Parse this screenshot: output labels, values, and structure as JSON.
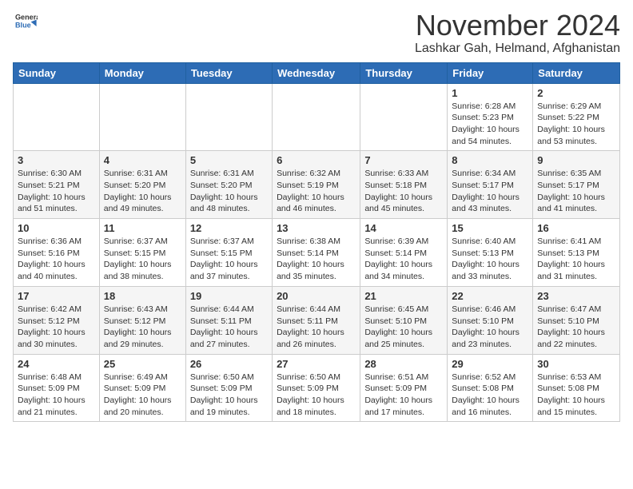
{
  "logo": {
    "general": "General",
    "blue": "Blue"
  },
  "header": {
    "month": "November 2024",
    "location": "Lashkar Gah, Helmand, Afghanistan"
  },
  "days_of_week": [
    "Sunday",
    "Monday",
    "Tuesday",
    "Wednesday",
    "Thursday",
    "Friday",
    "Saturday"
  ],
  "weeks": [
    [
      {
        "day": "",
        "info": ""
      },
      {
        "day": "",
        "info": ""
      },
      {
        "day": "",
        "info": ""
      },
      {
        "day": "",
        "info": ""
      },
      {
        "day": "",
        "info": ""
      },
      {
        "day": "1",
        "info": "Sunrise: 6:28 AM\nSunset: 5:23 PM\nDaylight: 10 hours and 54 minutes."
      },
      {
        "day": "2",
        "info": "Sunrise: 6:29 AM\nSunset: 5:22 PM\nDaylight: 10 hours and 53 minutes."
      }
    ],
    [
      {
        "day": "3",
        "info": "Sunrise: 6:30 AM\nSunset: 5:21 PM\nDaylight: 10 hours and 51 minutes."
      },
      {
        "day": "4",
        "info": "Sunrise: 6:31 AM\nSunset: 5:20 PM\nDaylight: 10 hours and 49 minutes."
      },
      {
        "day": "5",
        "info": "Sunrise: 6:31 AM\nSunset: 5:20 PM\nDaylight: 10 hours and 48 minutes."
      },
      {
        "day": "6",
        "info": "Sunrise: 6:32 AM\nSunset: 5:19 PM\nDaylight: 10 hours and 46 minutes."
      },
      {
        "day": "7",
        "info": "Sunrise: 6:33 AM\nSunset: 5:18 PM\nDaylight: 10 hours and 45 minutes."
      },
      {
        "day": "8",
        "info": "Sunrise: 6:34 AM\nSunset: 5:17 PM\nDaylight: 10 hours and 43 minutes."
      },
      {
        "day": "9",
        "info": "Sunrise: 6:35 AM\nSunset: 5:17 PM\nDaylight: 10 hours and 41 minutes."
      }
    ],
    [
      {
        "day": "10",
        "info": "Sunrise: 6:36 AM\nSunset: 5:16 PM\nDaylight: 10 hours and 40 minutes."
      },
      {
        "day": "11",
        "info": "Sunrise: 6:37 AM\nSunset: 5:15 PM\nDaylight: 10 hours and 38 minutes."
      },
      {
        "day": "12",
        "info": "Sunrise: 6:37 AM\nSunset: 5:15 PM\nDaylight: 10 hours and 37 minutes."
      },
      {
        "day": "13",
        "info": "Sunrise: 6:38 AM\nSunset: 5:14 PM\nDaylight: 10 hours and 35 minutes."
      },
      {
        "day": "14",
        "info": "Sunrise: 6:39 AM\nSunset: 5:14 PM\nDaylight: 10 hours and 34 minutes."
      },
      {
        "day": "15",
        "info": "Sunrise: 6:40 AM\nSunset: 5:13 PM\nDaylight: 10 hours and 33 minutes."
      },
      {
        "day": "16",
        "info": "Sunrise: 6:41 AM\nSunset: 5:13 PM\nDaylight: 10 hours and 31 minutes."
      }
    ],
    [
      {
        "day": "17",
        "info": "Sunrise: 6:42 AM\nSunset: 5:12 PM\nDaylight: 10 hours and 30 minutes."
      },
      {
        "day": "18",
        "info": "Sunrise: 6:43 AM\nSunset: 5:12 PM\nDaylight: 10 hours and 29 minutes."
      },
      {
        "day": "19",
        "info": "Sunrise: 6:44 AM\nSunset: 5:11 PM\nDaylight: 10 hours and 27 minutes."
      },
      {
        "day": "20",
        "info": "Sunrise: 6:44 AM\nSunset: 5:11 PM\nDaylight: 10 hours and 26 minutes."
      },
      {
        "day": "21",
        "info": "Sunrise: 6:45 AM\nSunset: 5:10 PM\nDaylight: 10 hours and 25 minutes."
      },
      {
        "day": "22",
        "info": "Sunrise: 6:46 AM\nSunset: 5:10 PM\nDaylight: 10 hours and 23 minutes."
      },
      {
        "day": "23",
        "info": "Sunrise: 6:47 AM\nSunset: 5:10 PM\nDaylight: 10 hours and 22 minutes."
      }
    ],
    [
      {
        "day": "24",
        "info": "Sunrise: 6:48 AM\nSunset: 5:09 PM\nDaylight: 10 hours and 21 minutes."
      },
      {
        "day": "25",
        "info": "Sunrise: 6:49 AM\nSunset: 5:09 PM\nDaylight: 10 hours and 20 minutes."
      },
      {
        "day": "26",
        "info": "Sunrise: 6:50 AM\nSunset: 5:09 PM\nDaylight: 10 hours and 19 minutes."
      },
      {
        "day": "27",
        "info": "Sunrise: 6:50 AM\nSunset: 5:09 PM\nDaylight: 10 hours and 18 minutes."
      },
      {
        "day": "28",
        "info": "Sunrise: 6:51 AM\nSunset: 5:09 PM\nDaylight: 10 hours and 17 minutes."
      },
      {
        "day": "29",
        "info": "Sunrise: 6:52 AM\nSunset: 5:08 PM\nDaylight: 10 hours and 16 minutes."
      },
      {
        "day": "30",
        "info": "Sunrise: 6:53 AM\nSunset: 5:08 PM\nDaylight: 10 hours and 15 minutes."
      }
    ]
  ]
}
